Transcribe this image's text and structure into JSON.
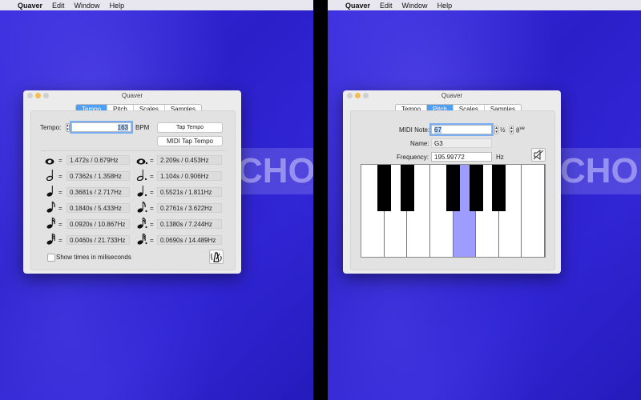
{
  "menubar": {
    "app": "Quaver",
    "items": [
      "Edit",
      "Window",
      "Help"
    ]
  },
  "watermark_text": "CHO",
  "left_window": {
    "title": "Quaver",
    "tabs": [
      {
        "label": "Tempo",
        "active": true
      },
      {
        "label": "Pitch",
        "active": false
      },
      {
        "label": "Scales",
        "active": false
      },
      {
        "label": "Samples",
        "active": false
      }
    ],
    "tempo_label": "Tempo:",
    "tempo_value": "163",
    "bpm_label": "BPM",
    "tap_tempo": "Tap Tempo",
    "midi_tap_tempo": "MIDI Tap Tempo",
    "rows": [
      {
        "note_a": "whole-note-icon",
        "value_a": "1.472s / 0.679Hz",
        "note_b": "dotted-whole-note-icon",
        "value_b": "2.209s / 0.453Hz"
      },
      {
        "note_a": "half-note-icon",
        "value_a": "0.7362s / 1.358Hz",
        "note_b": "dotted-half-note-icon",
        "value_b": "1.104s / 0.906Hz"
      },
      {
        "note_a": "quarter-note-icon",
        "value_a": "0.3681s / 2.717Hz",
        "note_b": "dotted-quarter-note-icon",
        "value_b": "0.5521s / 1.811Hz"
      },
      {
        "note_a": "eighth-note-icon",
        "value_a": "0.1840s / 5.433Hz",
        "note_b": "dotted-eighth-note-icon",
        "value_b": "0.2761s / 3.622Hz"
      },
      {
        "note_a": "sixteenth-note-icon",
        "value_a": "0.0920s / 10.867Hz",
        "note_b": "dotted-sixteenth-note-icon",
        "value_b": "0.1380s / 7.244Hz"
      },
      {
        "note_a": "thirtysecond-note-icon",
        "value_a": "0.0460s / 21.733Hz",
        "note_b": "dotted-thirtysecond-note-icon",
        "value_b": "0.0690s / 14.489Hz"
      }
    ],
    "equals": "=",
    "show_ms_label": "Show times in miliseconds",
    "metronome_icon": "metronome-icon"
  },
  "right_window": {
    "title": "Quaver",
    "tabs": [
      {
        "label": "Tempo",
        "active": false
      },
      {
        "label": "Pitch",
        "active": true
      },
      {
        "label": "Scales",
        "active": false
      },
      {
        "label": "Samples",
        "active": false
      }
    ],
    "midi_note_label": "MIDI Note:",
    "midi_note_value": "67",
    "half_step_label": "½",
    "octave_label": "8",
    "octave_sup": "ve",
    "name_label": "Name:",
    "name_value": "G3",
    "frequency_label": "Frequency:",
    "frequency_value": "195.99772",
    "hz_label": "Hz",
    "mute_icon": "speaker-muted-icon",
    "piano": {
      "white_keys": 8,
      "highlighted_white_key": 4,
      "black_keys_after_white": [
        0,
        1,
        3,
        4,
        5
      ]
    },
    "colors": {
      "highlight": "#9d9dff",
      "tab_active": "#4c9ef7"
    }
  }
}
